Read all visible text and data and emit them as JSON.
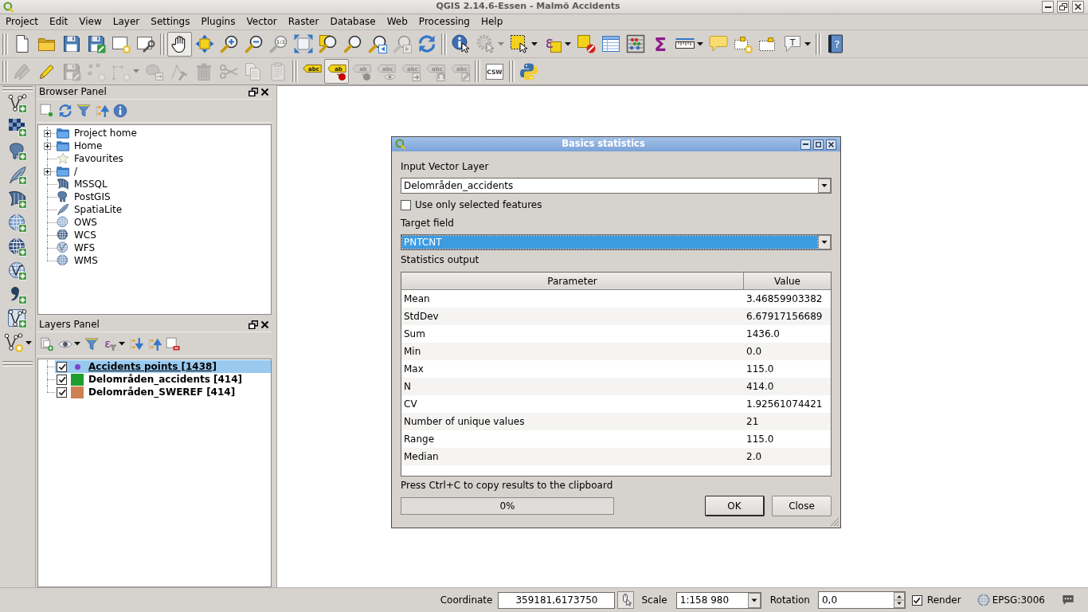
{
  "window": {
    "title": "QGIS 2.14.6-Essen - Malmö Accidents"
  },
  "menu_bar": [
    "Project",
    "Edit",
    "View",
    "Layer",
    "Settings",
    "Plugins",
    "Vector",
    "Raster",
    "Database",
    "Web",
    "Processing",
    "Help"
  ],
  "toolbar_rows": [
    {
      "toolbars": [
        {
          "buttons": [
            {
              "disabled": false,
              "pressed": false
            },
            {
              "disabled": false,
              "pressed": false
            },
            {
              "disabled": false,
              "pressed": false
            },
            {
              "disabled": false,
              "pressed": false
            },
            {
              "disabled": false,
              "pressed": false
            },
            {
              "disabled": false,
              "pressed": false
            }
          ]
        },
        {
          "buttons": [
            {
              "disabled": false,
              "pressed": true
            },
            {
              "disabled": false,
              "pressed": false
            },
            {
              "disabled": false,
              "pressed": false
            },
            {
              "disabled": false,
              "pressed": false
            },
            {
              "disabled": false,
              "pressed": false,
              "icon_text": "1:1"
            },
            {
              "disabled": false,
              "pressed": false
            },
            {
              "disabled": false,
              "pressed": false
            },
            {
              "disabled": false,
              "pressed": false
            },
            {
              "disabled": false,
              "pressed": false
            },
            {
              "disabled": true,
              "pressed": false
            },
            {
              "disabled": false,
              "pressed": false
            }
          ]
        },
        {
          "buttons": [
            {
              "disabled": false,
              "pressed": false
            },
            {
              "disabled": true,
              "pressed": false
            },
            {
              "disabled": false,
              "pressed": false
            },
            {
              "disabled": false,
              "pressed": false,
              "icon_text": "ε"
            },
            {
              "disabled": false,
              "pressed": false
            },
            {
              "disabled": false,
              "pressed": false
            },
            {
              "disabled": false,
              "pressed": false
            },
            {
              "disabled": false,
              "pressed": false,
              "icon_text": "Σ"
            },
            {
              "disabled": false,
              "pressed": false
            },
            {
              "disabled": false,
              "pressed": false
            },
            {
              "disabled": false,
              "pressed": false
            },
            {
              "disabled": false,
              "pressed": false
            },
            {
              "disabled": false,
              "pressed": false,
              "icon_text": "T"
            }
          ]
        },
        {
          "buttons": [
            {
              "disabled": false,
              "pressed": false,
              "icon_text": "?"
            }
          ]
        }
      ]
    },
    {
      "toolbars": [
        {
          "buttons": [
            {
              "disabled": true,
              "pressed": false
            },
            {
              "disabled": false,
              "pressed": false
            },
            {
              "disabled": true,
              "pressed": false
            },
            {
              "disabled": true,
              "pressed": false
            },
            {
              "disabled": true,
              "pressed": false
            },
            {
              "disabled": true,
              "pressed": false
            },
            {
              "disabled": true,
              "pressed": false
            },
            {
              "disabled": true,
              "pressed": false
            },
            {
              "disabled": true,
              "pressed": false
            },
            {
              "disabled": true,
              "pressed": false
            },
            {
              "disabled": true,
              "pressed": false
            }
          ]
        },
        {
          "buttons": [
            {
              "disabled": false,
              "pressed": false,
              "icon_text": "abc"
            },
            {
              "disabled": false,
              "pressed": true,
              "icon_text": "ab"
            },
            {
              "disabled": true,
              "pressed": false,
              "icon_text": "ab"
            },
            {
              "disabled": true,
              "pressed": false,
              "icon_text": "abc"
            },
            {
              "disabled": true,
              "pressed": false,
              "icon_text": "abc"
            },
            {
              "disabled": true,
              "pressed": false,
              "icon_text": "abc"
            },
            {
              "disabled": true,
              "pressed": false,
              "icon_text": "abc"
            }
          ]
        },
        {
          "buttons": [
            {
              "disabled": false,
              "pressed": false,
              "icon_text": "CSW"
            }
          ]
        },
        {
          "buttons": [
            {
              "disabled": false,
              "pressed": false
            }
          ]
        }
      ]
    }
  ],
  "side_toolbar": {
    "buttons": [
      {
        "disabled": false
      },
      {
        "disabled": false
      },
      {
        "disabled": false
      },
      {
        "disabled": false
      },
      {
        "disabled": false
      },
      {
        "disabled": false
      },
      {
        "disabled": false
      },
      {
        "disabled": false
      },
      {
        "disabled": false
      },
      {
        "disabled": false
      },
      {
        "disabled": false
      }
    ]
  },
  "browser_panel": {
    "title": "Browser Panel",
    "toolbar": {
      "buttons": [
        {
          "disabled": false
        },
        {
          "disabled": false
        },
        {
          "disabled": false
        },
        {
          "disabled": false
        },
        {
          "disabled": false
        }
      ]
    },
    "tree": [
      {
        "label": "Project home",
        "expandable": true
      },
      {
        "label": "Home",
        "expandable": true
      },
      {
        "label": "Favourites",
        "expandable": false
      },
      {
        "label": "/",
        "expandable": true
      },
      {
        "label": "MSSQL",
        "expandable": false
      },
      {
        "label": "PostGIS",
        "expandable": false
      },
      {
        "label": "SpatiaLite",
        "expandable": false
      },
      {
        "label": "OWS",
        "expandable": false
      },
      {
        "label": "WCS",
        "expandable": false
      },
      {
        "label": "WFS",
        "expandable": false
      },
      {
        "label": "WMS",
        "expandable": false
      }
    ]
  },
  "layers_panel": {
    "title": "Layers Panel",
    "toolbar": {
      "buttons": [
        {
          "disabled": false
        },
        {
          "disabled": false
        },
        {
          "disabled": false
        },
        {
          "disabled": false,
          "icon_text": "ε"
        },
        {
          "disabled": false
        },
        {
          "disabled": false
        },
        {
          "disabled": false
        }
      ]
    },
    "layers": [
      {
        "name": "Accidents points [1438]",
        "kind": "point",
        "color": "#8040d0",
        "visible": true,
        "selected": true
      },
      {
        "name": "Delområden_accidents [414]",
        "kind": "polygon",
        "color": "#1e9e2e",
        "visible": true,
        "selected": false
      },
      {
        "name": "Delområden_SWEREF [414]",
        "kind": "polygon",
        "color": "#cd8050",
        "visible": true,
        "selected": false
      }
    ]
  },
  "dialog": {
    "title": "Basics statistics",
    "input_layer": {
      "label": "Input Vector Layer",
      "value": "Delområden_accidents",
      "focused": false
    },
    "selected_only": {
      "label": "Use only selected features",
      "checked": false
    },
    "target_field": {
      "label": "Target field",
      "value": "PNTCNT",
      "focused": true
    },
    "output": {
      "label": "Statistics output",
      "columns": [
        "Parameter",
        "Value"
      ],
      "rows": [
        [
          "Mean",
          "3.46859903382"
        ],
        [
          "StdDev",
          "6.67917156689"
        ],
        [
          "Sum",
          "1436.0"
        ],
        [
          "Min",
          "0.0"
        ],
        [
          "Max",
          "115.0"
        ],
        [
          "N",
          "414.0"
        ],
        [
          "CV",
          "1.92561074421"
        ],
        [
          "Number of unique values",
          "21"
        ],
        [
          "Range",
          "115.0"
        ],
        [
          "Median",
          "2.0"
        ]
      ]
    },
    "hint": "Press Ctrl+C to copy results to the clipboard",
    "progress": {
      "level": 0,
      "text": "0%"
    },
    "buttons": [
      {
        "label": "OK",
        "default": true
      },
      {
        "label": "Close",
        "default": false
      }
    ]
  },
  "status_bar": {
    "coordinate": {
      "label": "Coordinate",
      "value": "359181,6173750"
    },
    "scale": {
      "label": "Scale",
      "value": "1:158 980"
    },
    "rotation": {
      "label": "Rotation",
      "value": "0,0"
    },
    "render": {
      "label": "Render",
      "checked": true
    },
    "crs": "EPSG:3006"
  }
}
